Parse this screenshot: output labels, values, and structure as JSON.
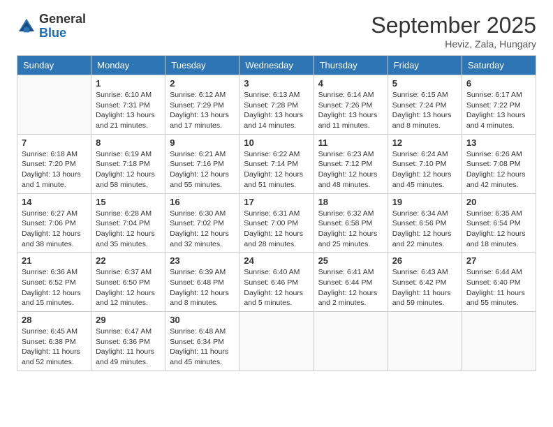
{
  "logo": {
    "general": "General",
    "blue": "Blue"
  },
  "header": {
    "month": "September 2025",
    "location": "Heviz, Zala, Hungary"
  },
  "weekdays": [
    "Sunday",
    "Monday",
    "Tuesday",
    "Wednesday",
    "Thursday",
    "Friday",
    "Saturday"
  ],
  "weeks": [
    [
      {
        "day": "",
        "info": ""
      },
      {
        "day": "1",
        "info": "Sunrise: 6:10 AM\nSunset: 7:31 PM\nDaylight: 13 hours and 21 minutes."
      },
      {
        "day": "2",
        "info": "Sunrise: 6:12 AM\nSunset: 7:29 PM\nDaylight: 13 hours and 17 minutes."
      },
      {
        "day": "3",
        "info": "Sunrise: 6:13 AM\nSunset: 7:28 PM\nDaylight: 13 hours and 14 minutes."
      },
      {
        "day": "4",
        "info": "Sunrise: 6:14 AM\nSunset: 7:26 PM\nDaylight: 13 hours and 11 minutes."
      },
      {
        "day": "5",
        "info": "Sunrise: 6:15 AM\nSunset: 7:24 PM\nDaylight: 13 hours and 8 minutes."
      },
      {
        "day": "6",
        "info": "Sunrise: 6:17 AM\nSunset: 7:22 PM\nDaylight: 13 hours and 4 minutes."
      }
    ],
    [
      {
        "day": "7",
        "info": "Sunrise: 6:18 AM\nSunset: 7:20 PM\nDaylight: 13 hours and 1 minute."
      },
      {
        "day": "8",
        "info": "Sunrise: 6:19 AM\nSunset: 7:18 PM\nDaylight: 12 hours and 58 minutes."
      },
      {
        "day": "9",
        "info": "Sunrise: 6:21 AM\nSunset: 7:16 PM\nDaylight: 12 hours and 55 minutes."
      },
      {
        "day": "10",
        "info": "Sunrise: 6:22 AM\nSunset: 7:14 PM\nDaylight: 12 hours and 51 minutes."
      },
      {
        "day": "11",
        "info": "Sunrise: 6:23 AM\nSunset: 7:12 PM\nDaylight: 12 hours and 48 minutes."
      },
      {
        "day": "12",
        "info": "Sunrise: 6:24 AM\nSunset: 7:10 PM\nDaylight: 12 hours and 45 minutes."
      },
      {
        "day": "13",
        "info": "Sunrise: 6:26 AM\nSunset: 7:08 PM\nDaylight: 12 hours and 42 minutes."
      }
    ],
    [
      {
        "day": "14",
        "info": "Sunrise: 6:27 AM\nSunset: 7:06 PM\nDaylight: 12 hours and 38 minutes."
      },
      {
        "day": "15",
        "info": "Sunrise: 6:28 AM\nSunset: 7:04 PM\nDaylight: 12 hours and 35 minutes."
      },
      {
        "day": "16",
        "info": "Sunrise: 6:30 AM\nSunset: 7:02 PM\nDaylight: 12 hours and 32 minutes."
      },
      {
        "day": "17",
        "info": "Sunrise: 6:31 AM\nSunset: 7:00 PM\nDaylight: 12 hours and 28 minutes."
      },
      {
        "day": "18",
        "info": "Sunrise: 6:32 AM\nSunset: 6:58 PM\nDaylight: 12 hours and 25 minutes."
      },
      {
        "day": "19",
        "info": "Sunrise: 6:34 AM\nSunset: 6:56 PM\nDaylight: 12 hours and 22 minutes."
      },
      {
        "day": "20",
        "info": "Sunrise: 6:35 AM\nSunset: 6:54 PM\nDaylight: 12 hours and 18 minutes."
      }
    ],
    [
      {
        "day": "21",
        "info": "Sunrise: 6:36 AM\nSunset: 6:52 PM\nDaylight: 12 hours and 15 minutes."
      },
      {
        "day": "22",
        "info": "Sunrise: 6:37 AM\nSunset: 6:50 PM\nDaylight: 12 hours and 12 minutes."
      },
      {
        "day": "23",
        "info": "Sunrise: 6:39 AM\nSunset: 6:48 PM\nDaylight: 12 hours and 8 minutes."
      },
      {
        "day": "24",
        "info": "Sunrise: 6:40 AM\nSunset: 6:46 PM\nDaylight: 12 hours and 5 minutes."
      },
      {
        "day": "25",
        "info": "Sunrise: 6:41 AM\nSunset: 6:44 PM\nDaylight: 12 hours and 2 minutes."
      },
      {
        "day": "26",
        "info": "Sunrise: 6:43 AM\nSunset: 6:42 PM\nDaylight: 11 hours and 59 minutes."
      },
      {
        "day": "27",
        "info": "Sunrise: 6:44 AM\nSunset: 6:40 PM\nDaylight: 11 hours and 55 minutes."
      }
    ],
    [
      {
        "day": "28",
        "info": "Sunrise: 6:45 AM\nSunset: 6:38 PM\nDaylight: 11 hours and 52 minutes."
      },
      {
        "day": "29",
        "info": "Sunrise: 6:47 AM\nSunset: 6:36 PM\nDaylight: 11 hours and 49 minutes."
      },
      {
        "day": "30",
        "info": "Sunrise: 6:48 AM\nSunset: 6:34 PM\nDaylight: 11 hours and 45 minutes."
      },
      {
        "day": "",
        "info": ""
      },
      {
        "day": "",
        "info": ""
      },
      {
        "day": "",
        "info": ""
      },
      {
        "day": "",
        "info": ""
      }
    ]
  ]
}
